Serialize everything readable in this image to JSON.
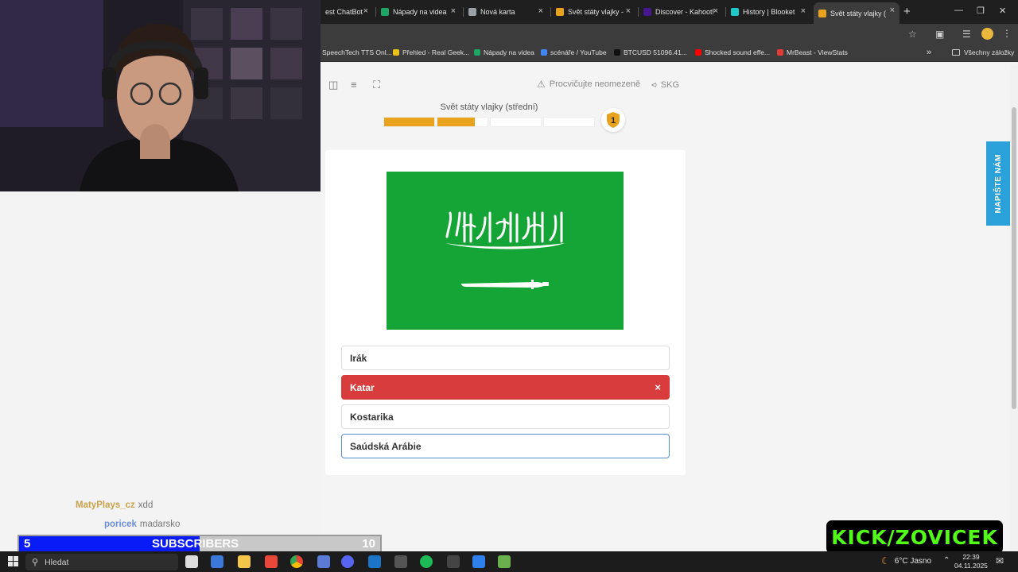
{
  "browser": {
    "tabs": [
      {
        "label": "est ChatBot",
        "favicon_color": "#1f1f1f"
      },
      {
        "label": "Nápady na videa",
        "favicon_color": "#1fa463"
      },
      {
        "label": "Nová karta",
        "favicon_color": "#9aa0a6"
      },
      {
        "label": "Svět státy vlajky -",
        "favicon_color": "#e8a21b"
      },
      {
        "label": "Discover - Kahoot!",
        "favicon_color": "#46178f"
      },
      {
        "label": "History | Blooket",
        "favicon_color": "#1ec8c8"
      },
      {
        "label": "Svět státy vlajky (",
        "favicon_color": "#e8a21b"
      }
    ],
    "new_tab_symbol": "+",
    "close_symbol": "×",
    "bookmarks": [
      {
        "label": "SpeechTech TTS Onl...",
        "favicon_color": "#3c3c3c"
      },
      {
        "label": "Přehled - Real Geek...",
        "favicon_color": "#e8c21b"
      },
      {
        "label": "Nápady na videa",
        "favicon_color": "#1fa463"
      },
      {
        "label": "scénáře / YouTube",
        "favicon_color": "#4285f4"
      },
      {
        "label": "BTCUSD 51096.41...",
        "favicon_color": "#111111"
      },
      {
        "label": "Shocked sound effe...",
        "favicon_color": "#ff0000"
      },
      {
        "label": "MrBeast - ViewStats",
        "favicon_color": "#e53935"
      }
    ],
    "all_bookmarks_label": "Všechny záložky",
    "more_symbol": "»"
  },
  "toolbar": {
    "practice_label": "Procvičujte neomezeně",
    "share_label": "SKG"
  },
  "quiz": {
    "title": "Svět státy vlajky (střední)",
    "progress_segments": [
      1.0,
      0.75,
      0.0,
      0.0
    ],
    "level_badge": "1",
    "accent_color": "#e8a21b"
  },
  "flag": {
    "country": "Saúdská Arábie",
    "background_color": "#15a537"
  },
  "answers": [
    {
      "label": "Irák",
      "state": "normal"
    },
    {
      "label": "Katar",
      "state": "wrong"
    },
    {
      "label": "Kostarika",
      "state": "normal"
    },
    {
      "label": "Saúdská Arábie",
      "state": "hover"
    }
  ],
  "wrong_mark": "×",
  "contact_button_label": "NAPIŠTE NÁM",
  "stream": {
    "chat": [
      {
        "user": "MatyPlays_cz",
        "message": "xdd",
        "user_color": "#c9a24a"
      },
      {
        "user": "poricek",
        "message": "madarsko",
        "user_color": "#6c8fd6"
      }
    ],
    "sub_goal": {
      "current": "5",
      "goal": "10",
      "label": "SUBSCRIBERS",
      "fill_fraction": 0.5
    },
    "kick_label": "KICK/ZOVICEK"
  },
  "taskbar": {
    "search_placeholder": "Hledat",
    "weather": "6°C Jasno",
    "time": "22:39",
    "date": "04.11.2025",
    "apps": [
      "task-view",
      "app-1",
      "file-explorer",
      "app-3",
      "chrome",
      "app-5",
      "discord",
      "vscode",
      "app-8",
      "spotify",
      "epic-games",
      "app-11",
      "minecraft"
    ]
  }
}
